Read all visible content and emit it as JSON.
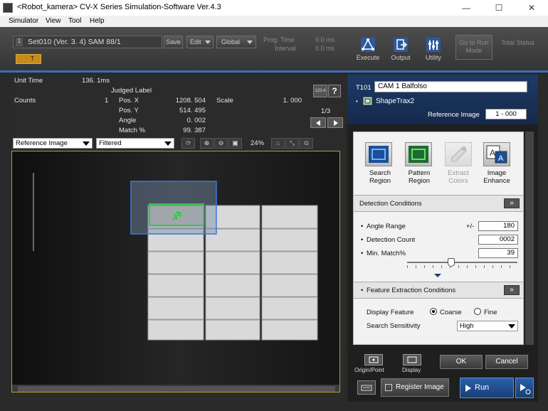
{
  "window": {
    "title": "<Robot_kamera> CV-X Series Simulation-Software Ver.4.3",
    "min": "—",
    "max": "☐",
    "close": "✕"
  },
  "menu": [
    "Simulator",
    "View",
    "Tool",
    "Help"
  ],
  "toolbar": {
    "setting": "Set010 (Ver. 3. 4) SAM 88/1",
    "save": "Save",
    "edit": "Edit",
    "global": "Global",
    "prog_time_label": "Prog. Time",
    "prog_time_value": "0.0 ms",
    "interval_label": "Interval",
    "interval_value": "0.0 ms",
    "execute": "Execute",
    "output": "Output",
    "utility": "Utility",
    "goto_run": "Go to Run Mode",
    "total_status": "Total Status",
    "tab_t": "T"
  },
  "results": {
    "unit_time_label": "Unit Time",
    "unit_time_value": "136. 1ms",
    "judged_label": "Judged Label",
    "counts_label": "Counts",
    "counts_value": "1",
    "pos_x_label": "Pos. X",
    "pos_x_value": "1208. 504",
    "scale_label": "Scale",
    "scale_value": "1. 000",
    "pos_y_label": "Pos. Y",
    "pos_y_value": "514. 495",
    "angle_label": "Angle",
    "angle_value": "0. 002",
    "match_label": "Match %",
    "match_value": "99. 387",
    "page": "1/3",
    "num_btn": "123.4",
    "help_btn": "?"
  },
  "viewer_bar": {
    "image_select": "Reference Image",
    "filter_select": "Filtered",
    "zoom": "24%"
  },
  "right": {
    "tool_id": "T101",
    "tool_name": "CAM 1 Balfolso",
    "tool_type": "ShapeTrax2",
    "ref_image_label": "Reference Image",
    "ref_image_value": "1 - 000",
    "icons": [
      {
        "label": "Search Region"
      },
      {
        "label": "Pattern Region"
      },
      {
        "label": "Extract Colors"
      },
      {
        "label": "Image Enhance"
      }
    ],
    "detection_title": "Detection Conditions",
    "angle_range_label": "Angle Range",
    "angle_range_pm": "+/-",
    "angle_range_value": "180",
    "detection_count_label": "Detection Count",
    "detection_count_value": "0002",
    "min_match_label": "Min. Match%",
    "min_match_value": "39",
    "feature_title": "Feature Extraction Conditions",
    "display_feature_label": "Display Feature",
    "coarse": "Coarse",
    "fine": "Fine",
    "search_sensitivity_label": "Search Sensitivity",
    "search_sensitivity_value": "High",
    "origin_point": "Origin/Point",
    "display": "Display",
    "ok": "OK",
    "cancel": "Cancel",
    "register_image": "Register Image",
    "run": "Run"
  }
}
